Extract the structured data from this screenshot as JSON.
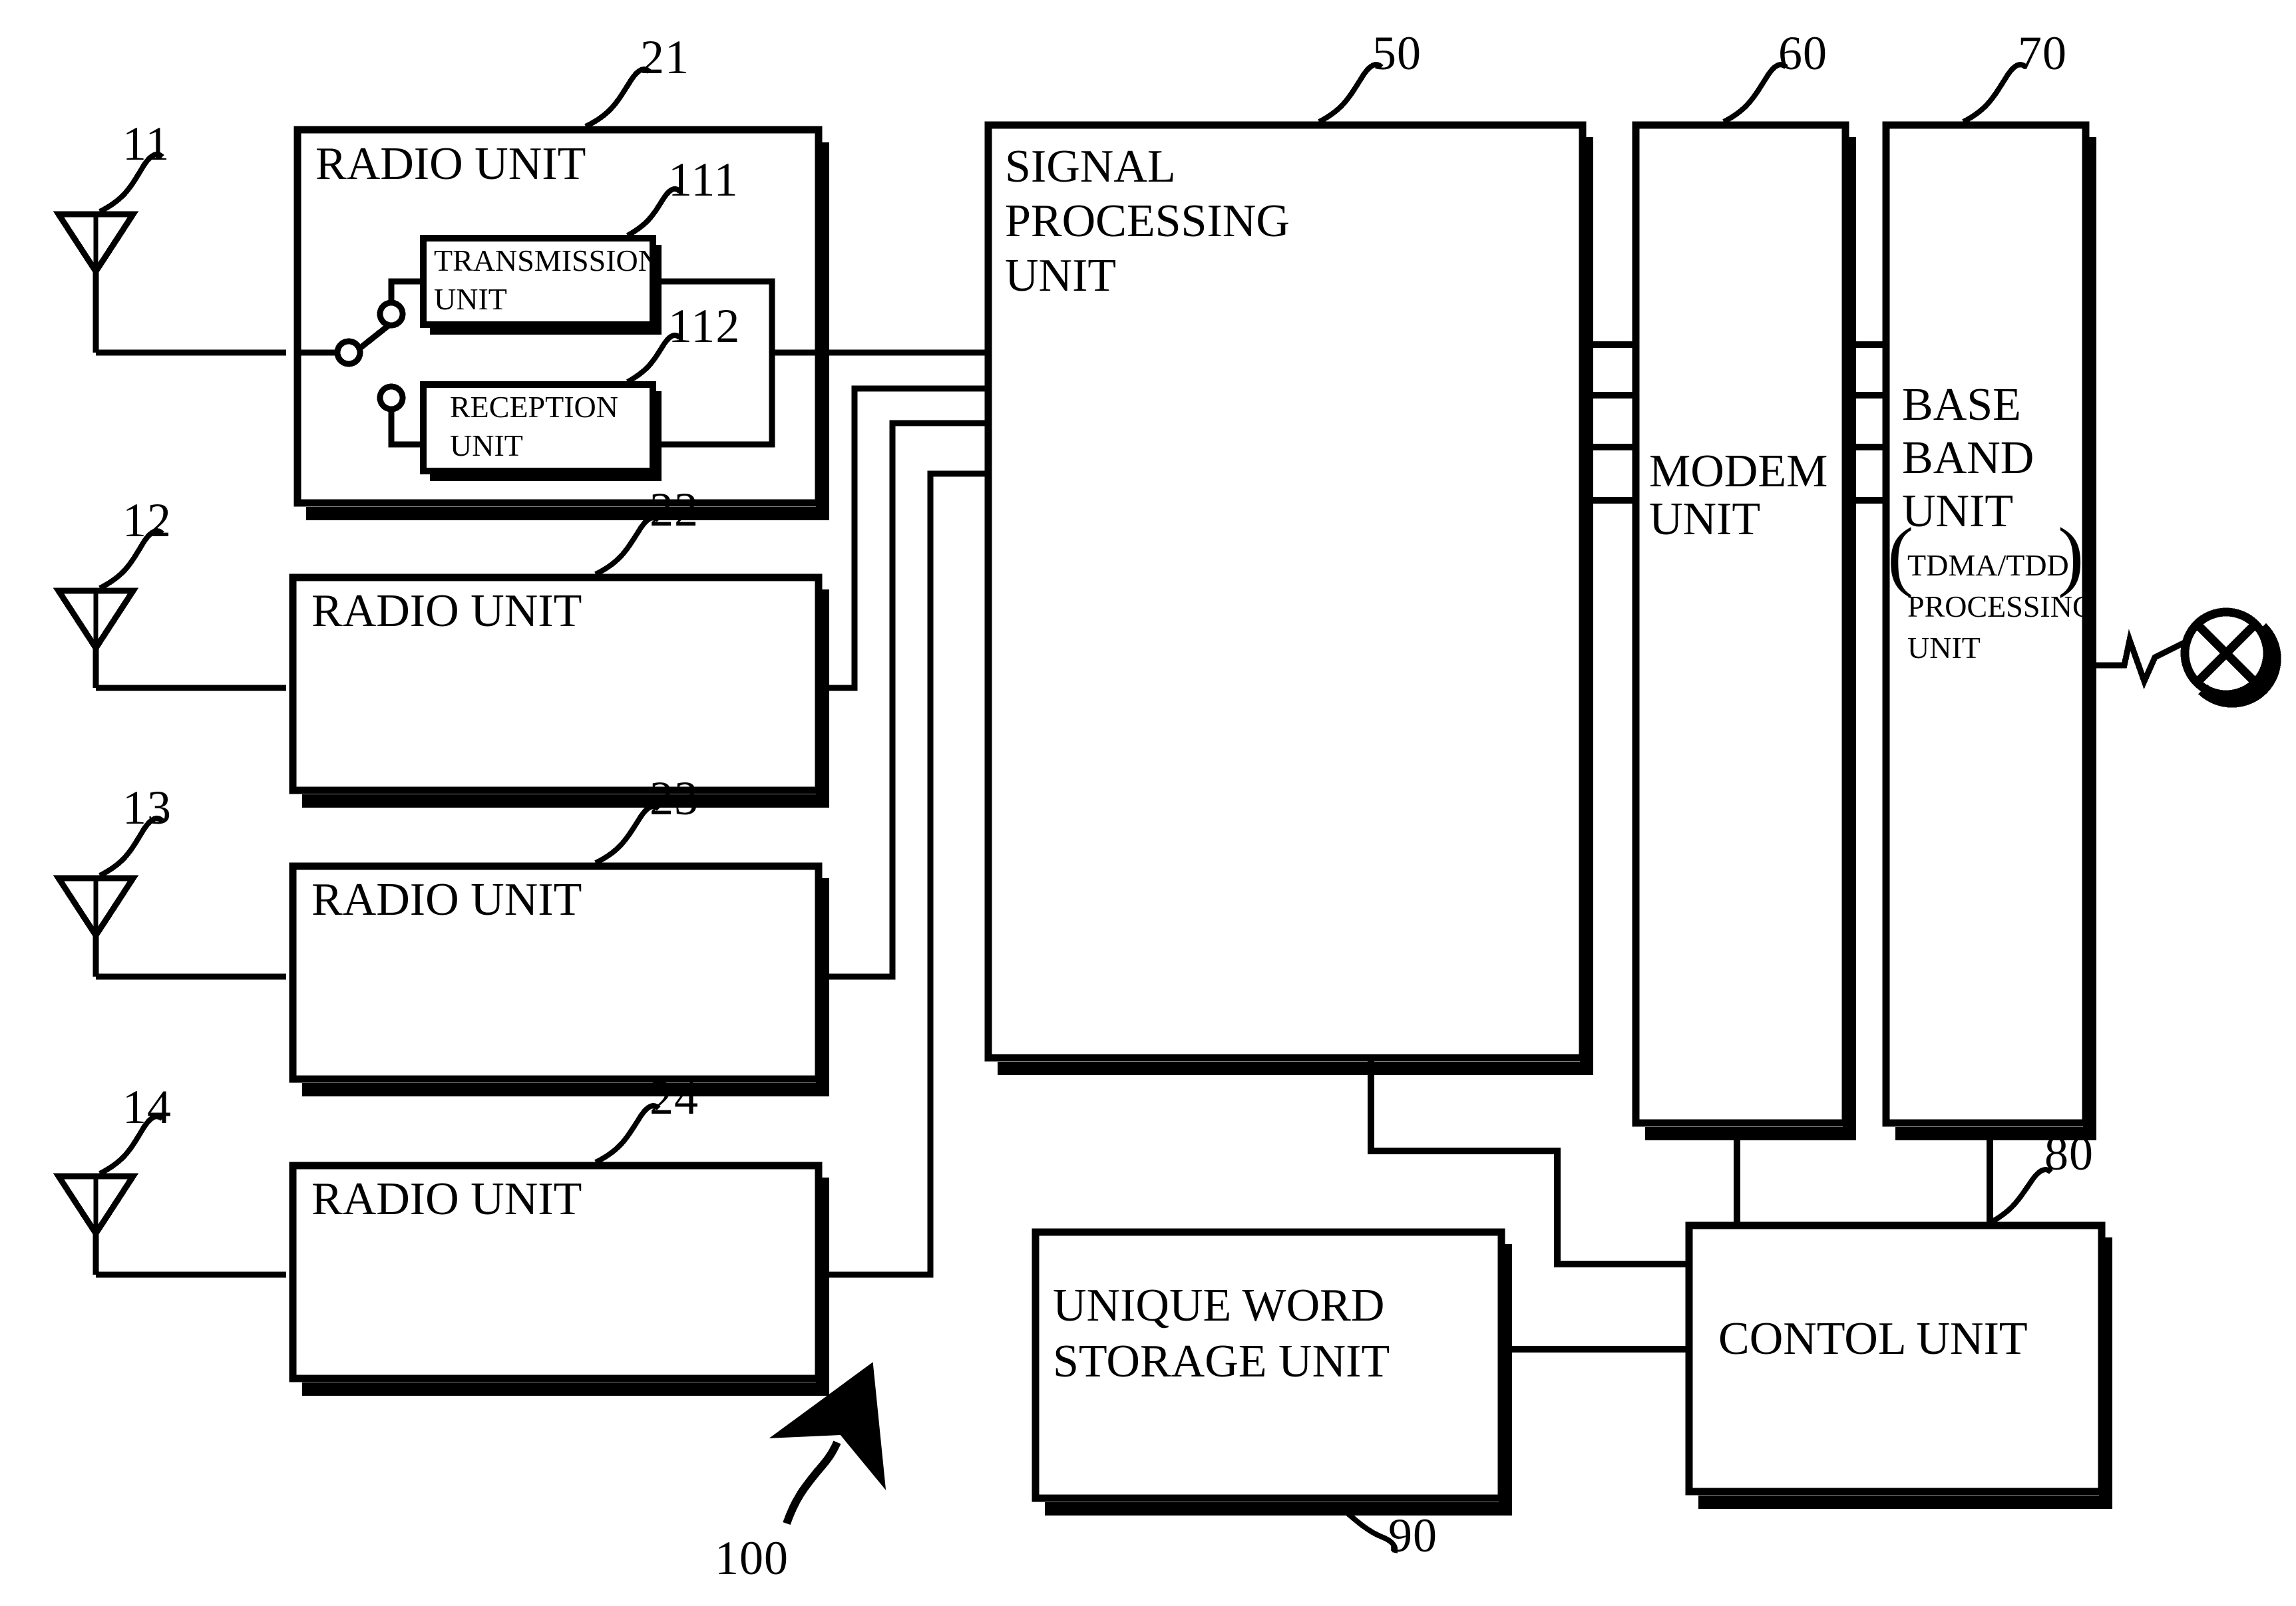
{
  "figure": {
    "kind": "patent-block-diagram",
    "assembly_ref": "100"
  },
  "antennas": [
    {
      "ref": "11",
      "name": "antenna-11"
    },
    {
      "ref": "12",
      "name": "antenna-12"
    },
    {
      "ref": "13",
      "name": "antenna-13"
    },
    {
      "ref": "14",
      "name": "antenna-14"
    }
  ],
  "radio_units": [
    {
      "ref": "21",
      "label": "RADIO UNIT"
    },
    {
      "ref": "22",
      "label": "RADIO UNIT"
    },
    {
      "ref": "23",
      "label": "RADIO UNIT"
    },
    {
      "ref": "24",
      "label": "RADIO UNIT"
    }
  ],
  "radio_unit_internals": {
    "transmission_unit": {
      "ref": "111",
      "line1": "TRANSMISSION",
      "line2": "UNIT"
    },
    "reception_unit": {
      "ref": "112",
      "line1": "RECEPTION",
      "line2": "UNIT"
    }
  },
  "signal_processing_unit": {
    "ref": "50",
    "line1": "SIGNAL",
    "line2": "PROCESSING",
    "line3": "UNIT"
  },
  "modem_unit": {
    "ref": "60",
    "line1": "MODEM",
    "line2": "UNIT"
  },
  "base_band_unit": {
    "ref": "70",
    "line1": "BASE",
    "line2": "BAND",
    "line3": "UNIT",
    "paren_open": "(",
    "paren_close": ")",
    "sub_line1": "TDMA/TDD",
    "sub_line2": "PROCESSING",
    "sub_line3": "UNIT"
  },
  "unique_word_storage_unit": {
    "ref": "90",
    "line1": "UNIQUE WORD",
    "line2": "STORAGE UNIT"
  },
  "control_unit": {
    "ref": "80",
    "label": "CONTOL UNIT"
  },
  "network_symbol": {
    "name": "crossed-circle-exchange-icon"
  }
}
